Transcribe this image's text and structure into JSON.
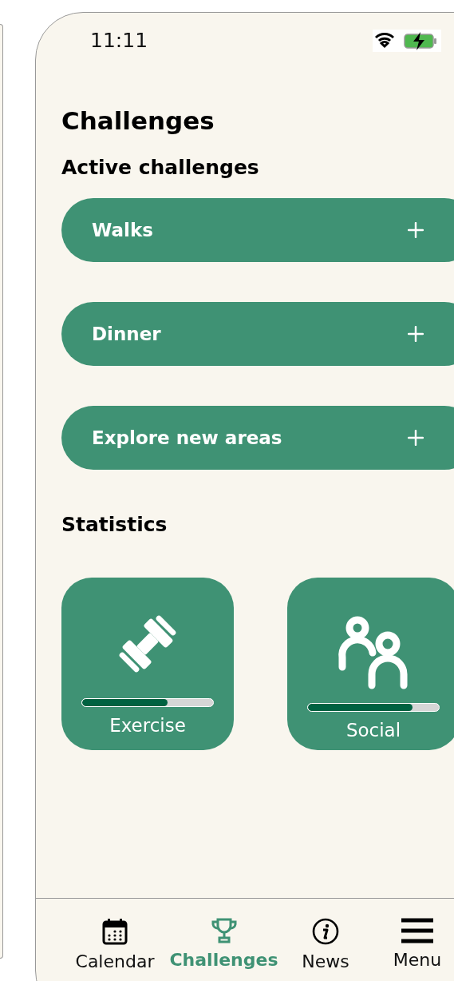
{
  "status_bar": {
    "time": "11:11"
  },
  "title": "Challenges",
  "active_heading": "Active challenges",
  "challenges": [
    {
      "label": "Walks"
    },
    {
      "label": "Dinner"
    },
    {
      "label": "Explore new areas"
    }
  ],
  "statistics_heading": "Statistics",
  "statistics": [
    {
      "kind": "exercise",
      "label": "Exercise",
      "level": 0.65
    },
    {
      "kind": "social",
      "label": "Social",
      "level": 0.8
    }
  ],
  "nav": [
    {
      "kind": "calendar",
      "label": "Calendar",
      "selected": false
    },
    {
      "kind": "trophy",
      "label": "Challenges",
      "selected": true
    },
    {
      "kind": "info",
      "label": "News",
      "selected": false
    },
    {
      "kind": "menu",
      "label": "Menu",
      "selected": false
    }
  ]
}
